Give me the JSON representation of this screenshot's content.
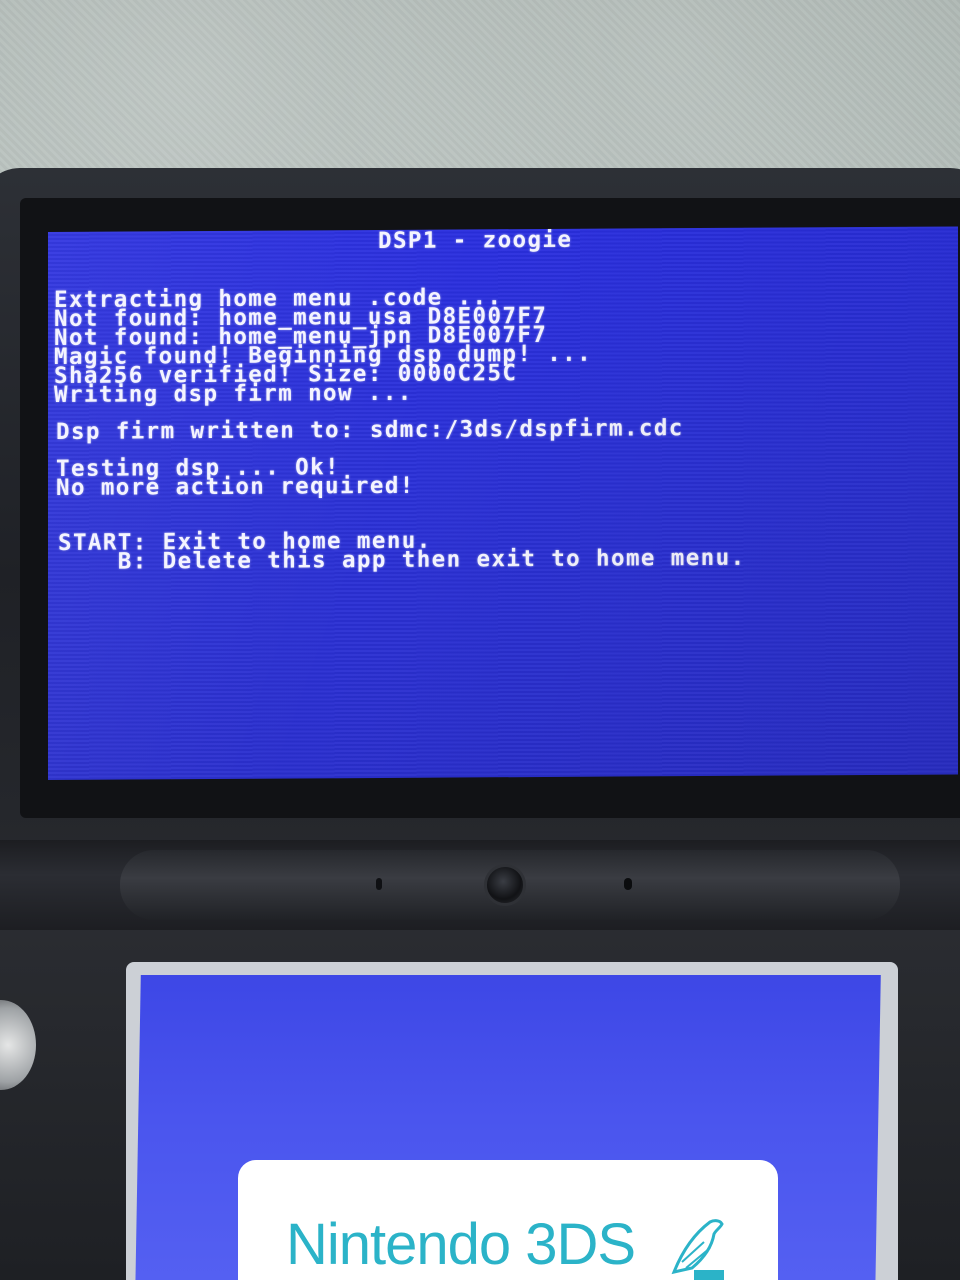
{
  "top_screen": {
    "title": "DSP1 - zoogie",
    "lines": [
      "Extracting home menu .code ...",
      "Not found: home_menu_usa D8E007F7",
      "Not found: home_menu_jpn D8E007F7",
      "Magic found! Beginning dsp dump! ...",
      "Sha256 verified! Size: 0000C25C",
      "Writing dsp firm now ...",
      "Dsp firm written to: sdmc:/3ds/dspfirm.cdc",
      "Testing dsp ... Ok!",
      "No more action required!",
      "START: Exit to home menu.",
      "    B: Delete this app then exit to home menu."
    ],
    "background_color": "#2b31d8",
    "text_color": "#f4f4ff"
  },
  "bottom_screen": {
    "brand_text": "Nintendo 3DS",
    "brand_icon": "bird-logo-icon",
    "brand_color": "#2bb3c8",
    "background_color": "#4a55ee"
  }
}
